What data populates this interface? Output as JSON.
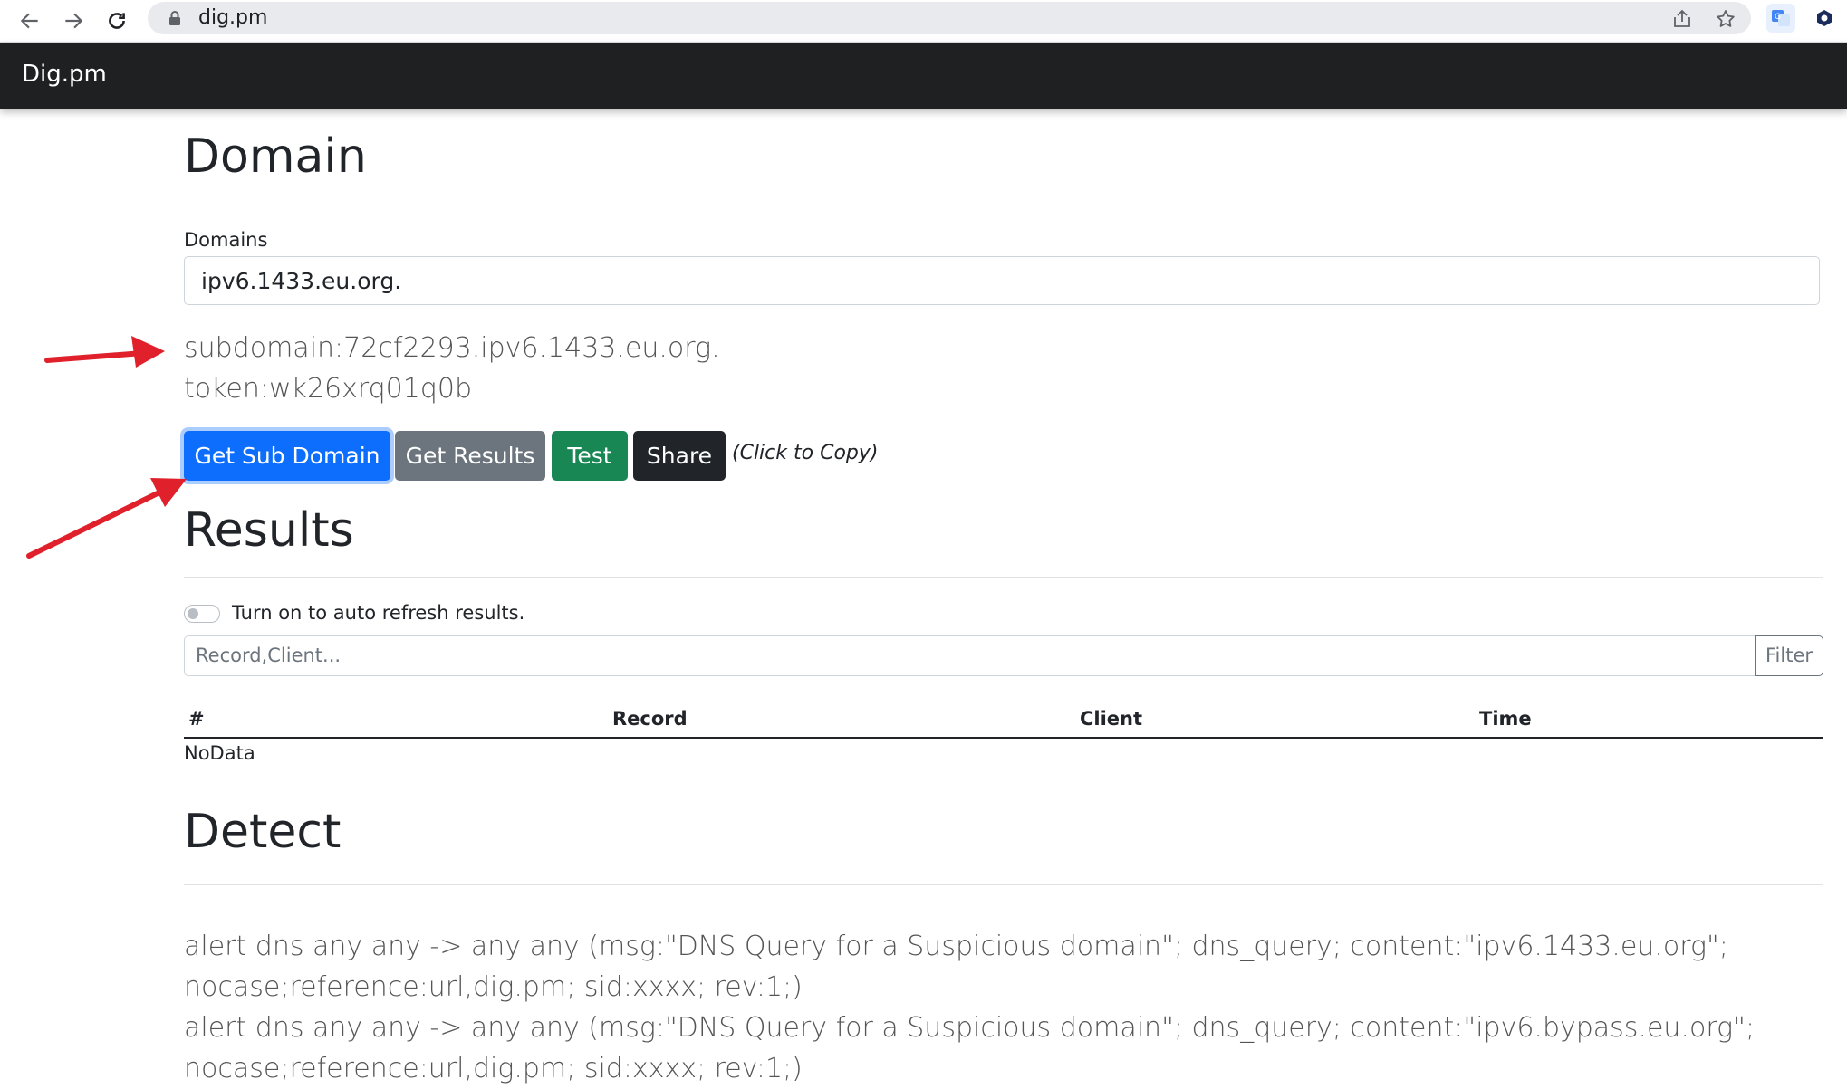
{
  "browser": {
    "url": "dig.pm",
    "back_icon": "arrow-left-icon",
    "forward_icon": "arrow-right-icon",
    "reload_icon": "reload-icon"
  },
  "app": {
    "brand": "Dig.pm"
  },
  "domain_section": {
    "title": "Domain",
    "domains_label": "Domains",
    "domains_value": "ipv6.1433.eu.org.",
    "subdomain_text": "subdomain:72cf2293.ipv6.1433.eu.org.",
    "token_text": "token:wk26xrq01q0b",
    "buttons": {
      "get_sub_domain": "Get Sub Domain",
      "get_results": "Get Results",
      "test": "Test",
      "share": "Share"
    },
    "copy_hint": "(Click to Copy)"
  },
  "results_section": {
    "title": "Results",
    "auto_refresh_label": "Turn on to auto refresh results.",
    "auto_refresh_on": false,
    "filter_placeholder": "Record,Client...",
    "filter_button": "Filter",
    "columns": [
      "#",
      "Record",
      "Client",
      "Time"
    ],
    "empty_text": "NoData"
  },
  "detect_section": {
    "title": "Detect",
    "rules": [
      "alert dns any any -> any any (msg:\"DNS Query for a Suspicious domain\"; dns_query; content:\"ipv6.1433.eu.org\";",
      "nocase;reference:url,dig.pm; sid:xxxx; rev:1;)",
      "alert dns any any -> any any (msg:\"DNS Query for a Suspicious domain\"; dns_query; content:\"ipv6.bypass.eu.org\";",
      "nocase;reference:url,dig.pm; sid:xxxx; rev:1;)"
    ]
  },
  "colors": {
    "navbar": "#1e2022",
    "primary": "#0d6efd",
    "secondary": "#6c757d",
    "success": "#198754",
    "dark": "#212529",
    "annotation_arrow": "#e0202a"
  }
}
